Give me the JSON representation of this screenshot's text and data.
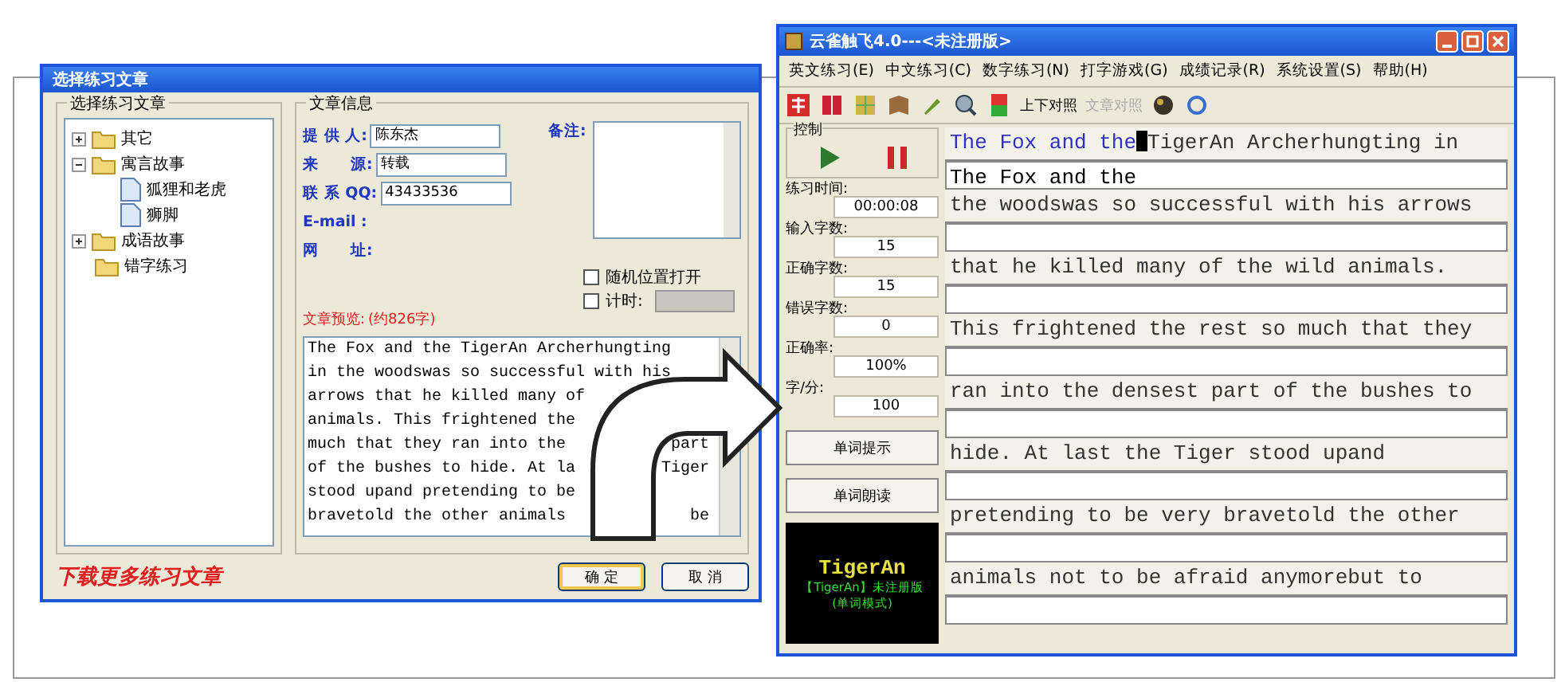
{
  "article_dialog": {
    "title": "选择练习文章",
    "tree_group_label": "选择练习文章",
    "tree": [
      {
        "label": "其它",
        "kind": "folder",
        "expanded": false
      },
      {
        "label": "寓言故事",
        "kind": "folder",
        "expanded": true,
        "children": [
          {
            "label": "狐狸和老虎",
            "kind": "file"
          },
          {
            "label": "狮脚",
            "kind": "file"
          }
        ]
      },
      {
        "label": "成语故事",
        "kind": "folder",
        "expanded": false
      },
      {
        "label": "错字练习",
        "kind": "plain-folder"
      }
    ],
    "info_group_label": "文章信息",
    "fields": [
      {
        "label": "提 供 人:",
        "value": "陈东杰"
      },
      {
        "label": "来　　源:",
        "value": "转载"
      },
      {
        "label": "联 系 QQ:",
        "value": "43433536"
      },
      {
        "label": "E-mail :"
      },
      {
        "label": "网　　址:"
      }
    ],
    "note_label": "备注:",
    "checkboxes": [
      {
        "label": "随机位置打开",
        "checked": false
      },
      {
        "label": "计时:",
        "checked": false
      }
    ],
    "preview_label": "文章预览:",
    "preview_count": "(约826字)",
    "preview_lines": [
      {
        "left": "The Fox and the TigerAn Archerhungting"
      },
      {
        "left": "in the woodswas so successful with his"
      },
      {
        "left": "arrows that he killed many of"
      },
      {
        "left": "animals. This frightened the"
      },
      {
        "left": "much that they ran into the",
        "right": "part"
      },
      {
        "left": "of the bushes to hide. At la",
        "right": "Tiger"
      },
      {
        "left": "stood upand pretending to be"
      },
      {
        "left": "bravetold the other animals",
        "right": "be"
      }
    ],
    "buttons": [
      {
        "label": "确 定",
        "focused": true
      },
      {
        "label": "取 消",
        "focused": false
      }
    ],
    "more_link": "下载更多练习文章"
  },
  "typing_window": {
    "title": "云雀触飞4.0---<未注册版>",
    "menu": [
      "英文练习(E)",
      "中文练习(C)",
      "数字练习(N)",
      "打字游戏(G)",
      "成绩记录(R)",
      "系统设置(S)",
      "帮助(H)"
    ],
    "toolbar_labels": [
      {
        "label": "上下对照",
        "disabled": false
      },
      {
        "label": "文章对照",
        "disabled": true
      }
    ],
    "control_label": "控制",
    "stats": [
      {
        "label": "练习时间:",
        "value": "00:00:08"
      },
      {
        "label": "输入字数:",
        "value": "15"
      },
      {
        "label": "正确字数:",
        "value": "15"
      },
      {
        "label": "错误字数:",
        "value": "0"
      },
      {
        "label": "正确率:",
        "value": "100%"
      },
      {
        "label": "字/分:",
        "value": "100"
      }
    ],
    "side_buttons": [
      "单词提示",
      "单词朗读"
    ],
    "logo": {
      "title": "TigerAn",
      "line1": "【TigerAn】未注册版",
      "line2": "(单词模式)"
    },
    "lines": [
      {
        "typed": "The Fox and the",
        "source": "TigerAn Archerhungting in",
        "input": "The Fox and the"
      },
      {
        "source": "the woodswas so successful with his arrows"
      },
      {
        "source": "that he killed many of the wild animals."
      },
      {
        "source": "This frightened the rest so much that they"
      },
      {
        "source": "ran into the densest part of the bushes to"
      },
      {
        "source": "hide. At last the Tiger stood upand"
      },
      {
        "source": "pretending to be very bravetold the other"
      },
      {
        "source": "animals not to be afraid anymorebut to"
      }
    ]
  }
}
